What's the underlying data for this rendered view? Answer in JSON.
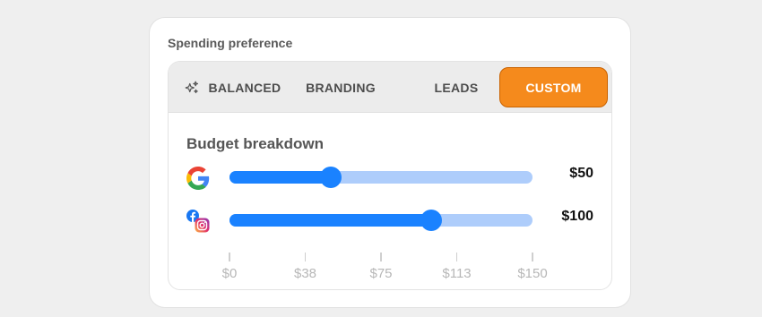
{
  "card": {
    "title": "Spending preference"
  },
  "tabs": [
    {
      "label": "BALANCED",
      "icon": "sparkle-icon",
      "active": false
    },
    {
      "label": "BRANDING",
      "active": false
    },
    {
      "label": "LEADS",
      "active": false
    },
    {
      "label": "CUSTOM",
      "active": true
    }
  ],
  "colors": {
    "accent": "#f58a1c",
    "slider_fill": "#1a82ff",
    "slider_track": "#aecdfb"
  },
  "breakdown": {
    "title": "Budget breakdown",
    "scale": {
      "min": 0,
      "max": 150
    },
    "ticks": [
      "$0",
      "$38",
      "$75",
      "$113",
      "$150"
    ],
    "channels": [
      {
        "name": "google",
        "icon": "google-icon",
        "amount_label": "$50",
        "value": 50
      },
      {
        "name": "meta",
        "icon": "facebook-instagram-icon",
        "amount_label": "$100",
        "value": 100
      }
    ]
  }
}
